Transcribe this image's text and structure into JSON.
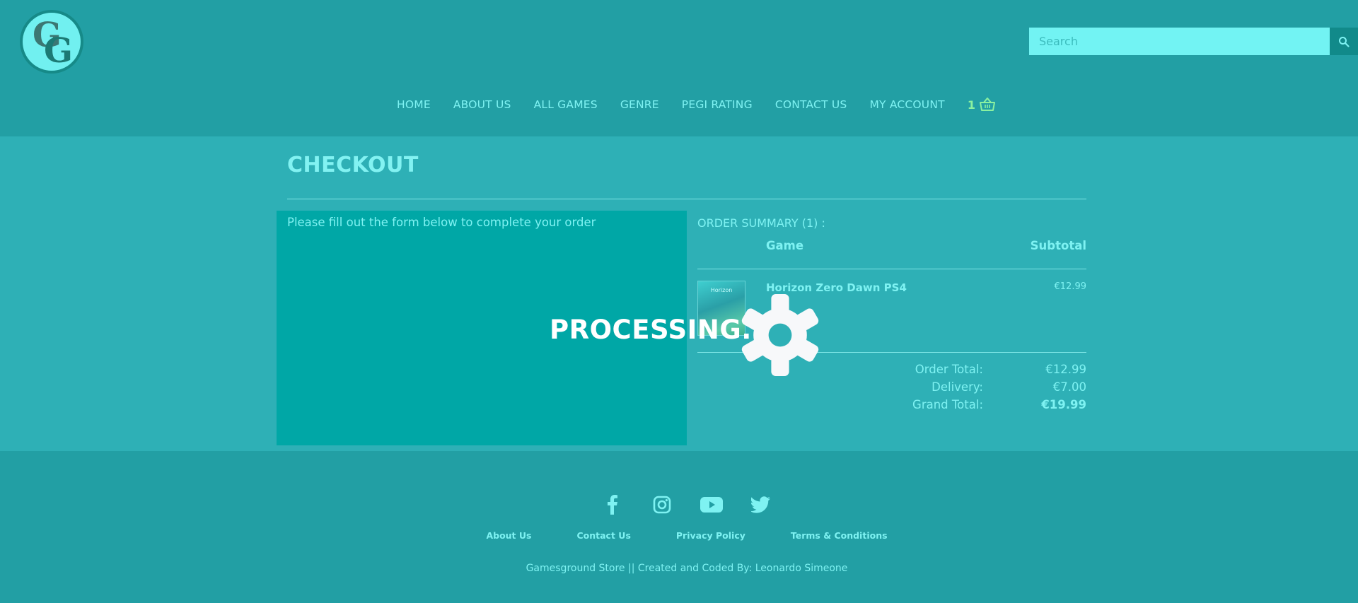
{
  "header": {
    "logo_text": "GG",
    "search": {
      "placeholder": "Search"
    },
    "nav": [
      "HOME",
      "ABOUT US",
      "ALL GAMES",
      "GENRE",
      "PEGI RATING",
      "CONTACT US",
      "MY ACCOUNT"
    ],
    "cart_count": "1"
  },
  "checkout": {
    "title": "CHECKOUT",
    "form_intro": "Please fill out the form below to complete your order",
    "summary_label": "ORDER SUMMARY (1) :",
    "col_game": "Game",
    "col_subtotal": "Subtotal",
    "item": {
      "name": "Horizon Zero Dawn PS4",
      "price": "€12.99",
      "thumb_text": "Horizon"
    },
    "totals": [
      {
        "label": "Order Total:",
        "value": "€12.99"
      },
      {
        "label": "Delivery:",
        "value": "€7.00"
      },
      {
        "label": "Grand Total:",
        "value": "€19.99"
      }
    ]
  },
  "overlay": {
    "text": "PROCESSING..."
  },
  "footer": {
    "links": [
      "About Us",
      "Contact Us",
      "Privacy Policy",
      "Terms & Conditions"
    ],
    "credit": "Gamesground Store || Created and Coded By: Leonardo Simeone"
  },
  "colors": {
    "header_bg": "#229fa4",
    "page_bg": "#2eb0b6",
    "form_bg": "#00a7a6",
    "text": "#7ef2f2",
    "cart": "#8bf1a0"
  },
  "icons": [
    "search-icon",
    "basket-icon",
    "gear-icon",
    "facebook-icon",
    "instagram-icon",
    "youtube-icon",
    "twitter-icon"
  ]
}
